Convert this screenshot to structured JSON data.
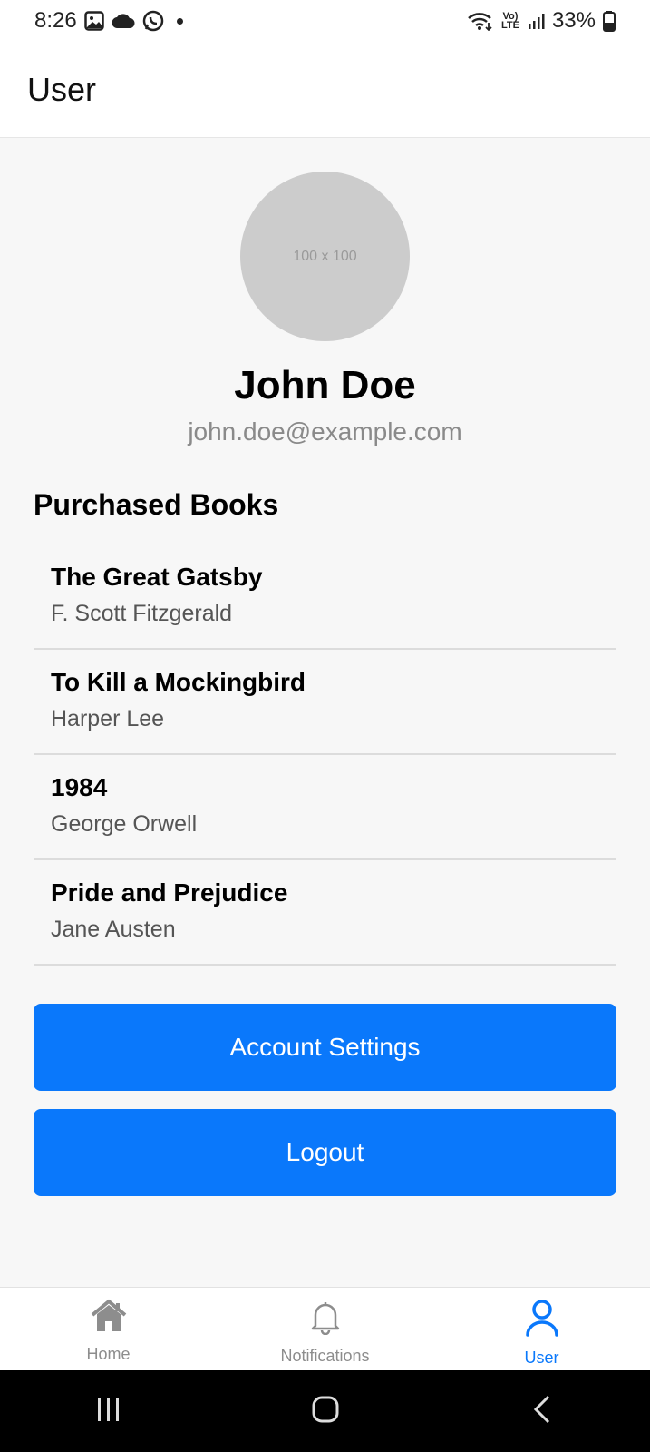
{
  "status_bar": {
    "time": "8:26",
    "battery": "33%",
    "lte_top": "Vo)",
    "lte_bottom": "LTE"
  },
  "header": {
    "title": "User"
  },
  "profile": {
    "avatar_placeholder": "100 x 100",
    "name": "John Doe",
    "email": "john.doe@example.com"
  },
  "purchased": {
    "title": "Purchased Books",
    "books": [
      {
        "title": "The Great Gatsby",
        "author": "F. Scott Fitzgerald"
      },
      {
        "title": "To Kill a Mockingbird",
        "author": "Harper Lee"
      },
      {
        "title": "1984",
        "author": "George Orwell"
      },
      {
        "title": "Pride and Prejudice",
        "author": "Jane Austen"
      }
    ]
  },
  "actions": {
    "settings_label": "Account Settings",
    "logout_label": "Logout"
  },
  "tabs": [
    {
      "label": "Home",
      "icon": "home-icon",
      "active": false
    },
    {
      "label": "Notifications",
      "icon": "bell-icon",
      "active": false
    },
    {
      "label": "User",
      "icon": "user-icon",
      "active": true
    }
  ],
  "colors": {
    "accent": "#0a78fb",
    "background": "#f7f7f7",
    "avatar": "#cccccc"
  }
}
